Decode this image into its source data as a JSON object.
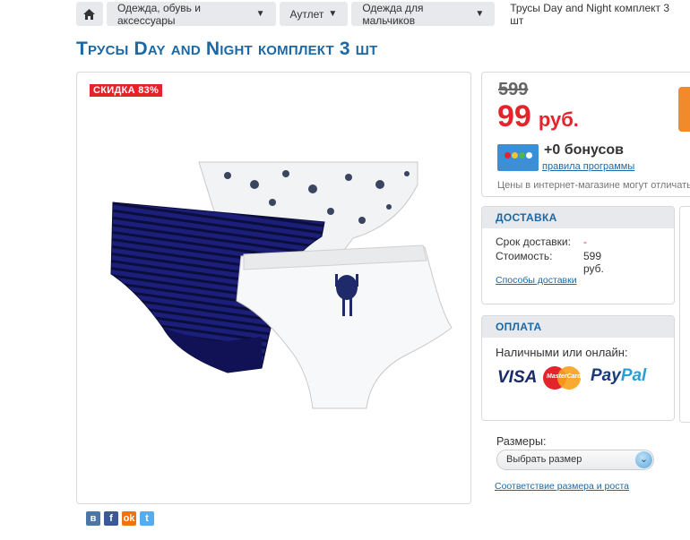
{
  "breadcrumb": {
    "items": [
      {
        "label": "Одежда, обувь и аксессуары",
        "arrow": "▼"
      },
      {
        "label": "Аутлет",
        "arrow": "▼"
      },
      {
        "label": "Одежда для мальчиков",
        "arrow": "▼"
      }
    ],
    "current": "Трусы Day and Night комплект 3 шт"
  },
  "product": {
    "title": "Трусы Day and Night комплект 3 шт",
    "discount_badge": "СКИДКА  83%"
  },
  "price": {
    "old": "599",
    "new": "99",
    "currency": "руб.",
    "bonus": "+0 бонусов",
    "bonus_link": "правила программы",
    "note": "Цены в интернет-магазине могут отличаться"
  },
  "delivery": {
    "title": "ДОСТАВКА",
    "time_label": "Срок доставки:",
    "time_value": "-",
    "cost_label": "Стоимость:",
    "cost_value": "599 руб.",
    "link": "Способы доставки"
  },
  "payment": {
    "title": "ОПЛАТА",
    "text": "Наличными или онлайн:",
    "visa": "VISA",
    "mastercard": "MasterCard",
    "paypal_1": "Pay",
    "paypal_2": "Pal"
  },
  "sizes": {
    "label": "Размеры:",
    "select_value": "Выбрать размер",
    "link": "Соответствие размера и роста"
  },
  "share": [
    {
      "name": "vk",
      "glyph": "в",
      "color": "#4a76a8"
    },
    {
      "name": "facebook",
      "glyph": "f",
      "color": "#3b5998"
    },
    {
      "name": "odnoklassniki",
      "glyph": "ok",
      "color": "#f2720c"
    },
    {
      "name": "twitter",
      "glyph": "t",
      "color": "#55acee"
    }
  ],
  "colors": {
    "accent_blue": "#1b68a6",
    "sale_red": "#e3242b",
    "buy_orange": "#f08a2a"
  }
}
